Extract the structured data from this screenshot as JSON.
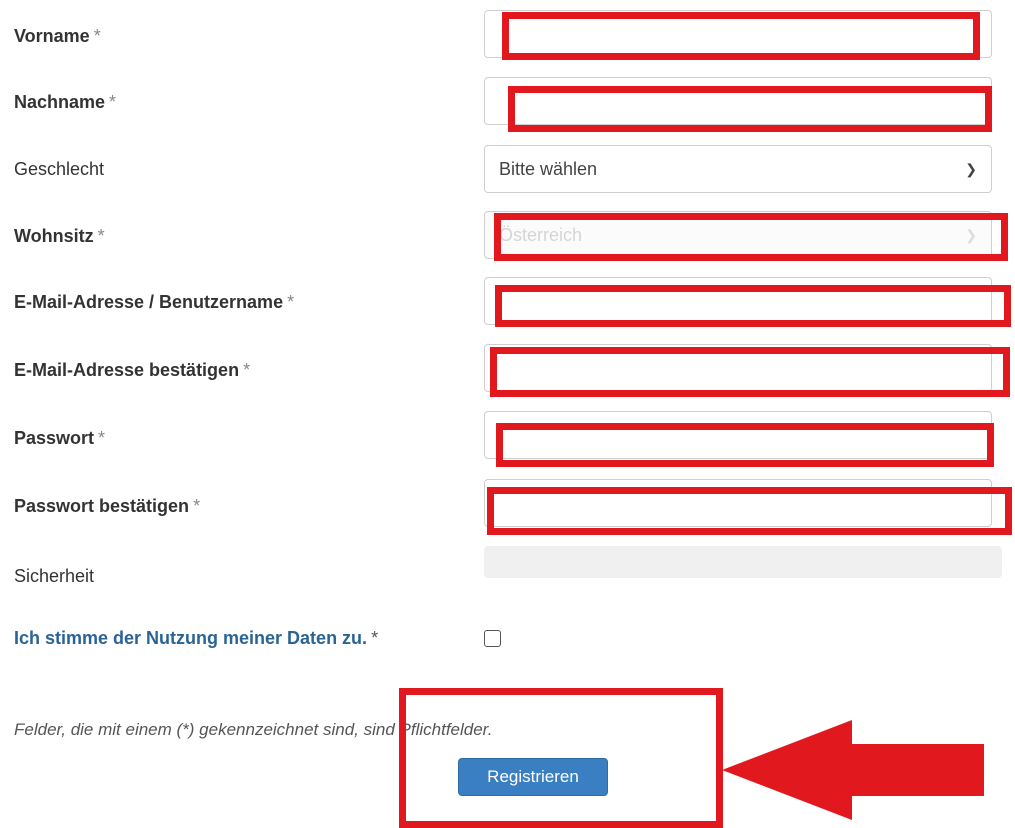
{
  "form": {
    "required_marker": "*",
    "fields": {
      "vorname": {
        "label": "Vorname",
        "value": ""
      },
      "nachname": {
        "label": "Nachname",
        "value": ""
      },
      "geschlecht": {
        "label": "Geschlecht",
        "selected": "Bitte wählen"
      },
      "wohnsitz": {
        "label": "Wohnsitz",
        "selected": "Österreich"
      },
      "email": {
        "label": "E-Mail-Adresse / Benutzername",
        "value": ""
      },
      "email_confirm": {
        "label": "E-Mail-Adresse bestätigen",
        "value": ""
      },
      "password": {
        "label": "Passwort",
        "value": ""
      },
      "password_confirm": {
        "label": "Passwort bestätigen",
        "value": ""
      }
    },
    "security": {
      "label": "Sicherheit"
    },
    "consent": {
      "label": "Ich stimme der Nutzung meiner Daten zu.",
      "checked": false
    },
    "note": "Felder, die mit einem (*) gekennzeichnet sind, sind Pflichtfelder.",
    "submit_label": "Registrieren"
  },
  "annotation": {
    "highlight_color": "#e1191f",
    "accent_color": "#3a7fc1",
    "link_color": "#2a6496"
  }
}
